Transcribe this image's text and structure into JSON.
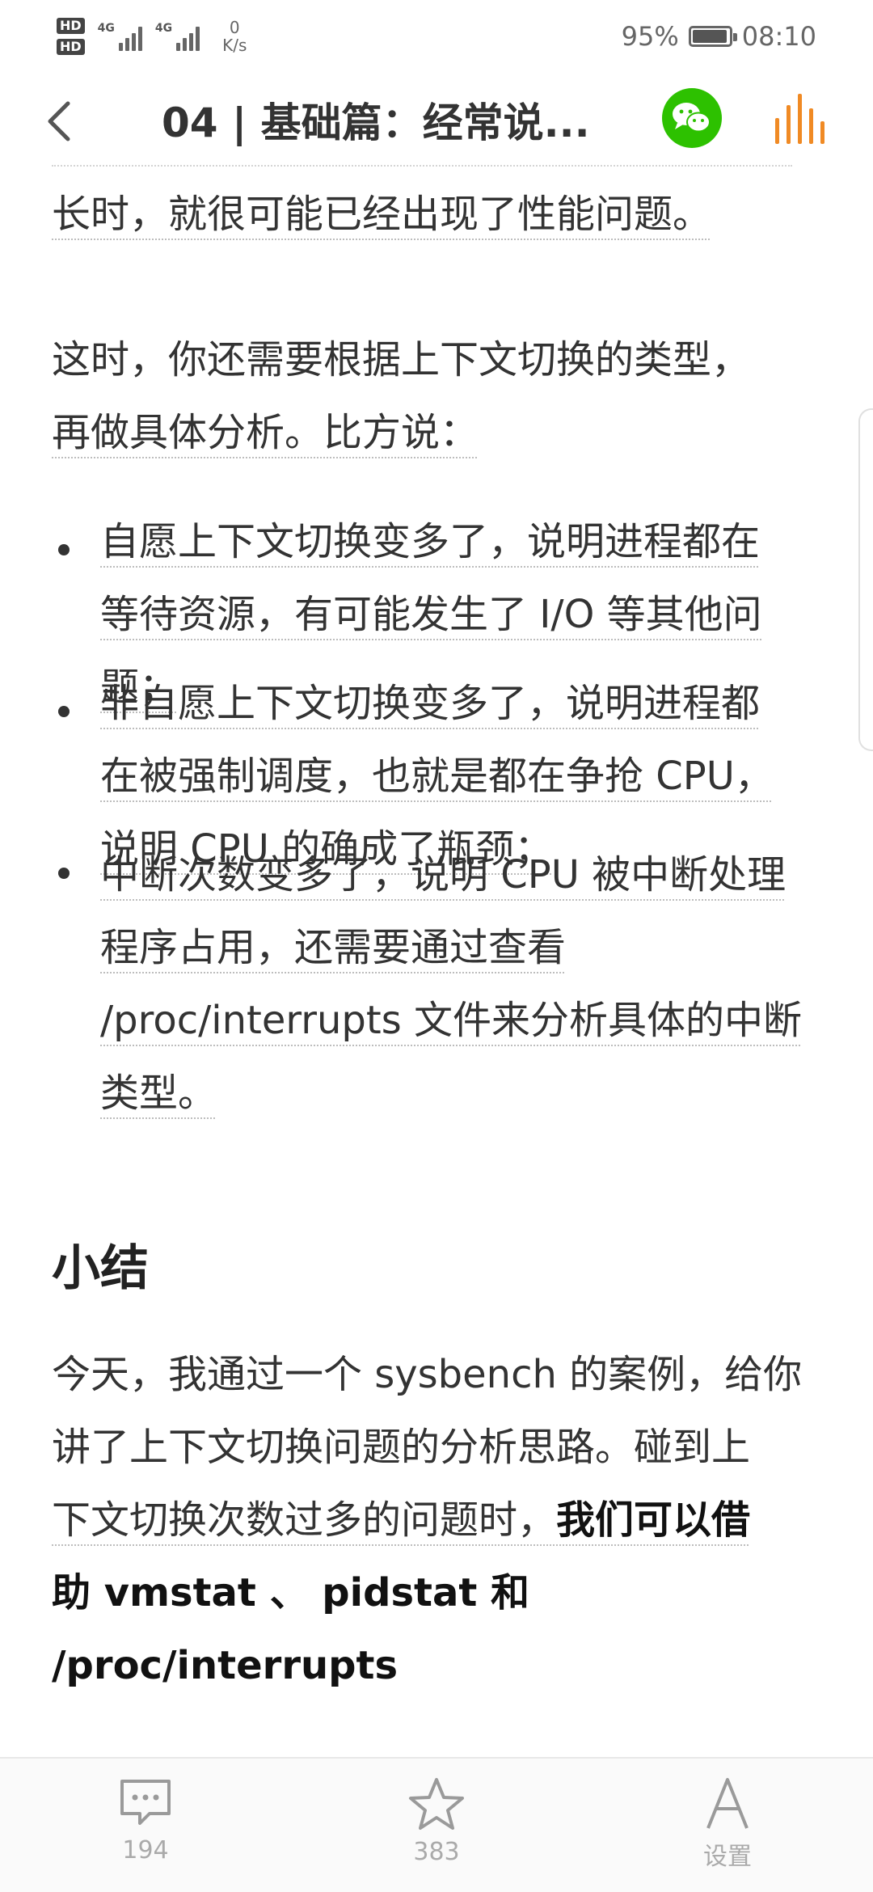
{
  "status_bar": {
    "hd1": "HD",
    "hd2": "HD",
    "network_1": "4G",
    "network_2": "4G",
    "speed_value": "0",
    "speed_unit": "K/s",
    "battery_percent": "95%",
    "battery_level": 0.95,
    "time": "08:10"
  },
  "header": {
    "title": "04 | 基础篇：经常说..."
  },
  "article": {
    "p1": "长时，就很可能已经出现了性能问题。",
    "p2_line1": "这时，你还需要根据上下文切换的类型，",
    "p2_line2": "再做具体分析。比方说：",
    "bullets": [
      {
        "lines": [
          "自愿上下文切换变多了，说明进程都在",
          "等待资源，有可能发生了 I/O 等其他问",
          "题；"
        ]
      },
      {
        "lines": [
          "非自愿上下文切换变多了，说明进程都",
          "在被强制调度，也就是都在争抢 CPU，",
          "说明 CPU 的确成了瓶颈；"
        ]
      },
      {
        "lines": [
          "中断次数变多了，说明 CPU 被中断处理",
          "程序占用，还需要通过查看",
          "/proc/interrupts 文件来分析具体的中断",
          "类型。"
        ]
      }
    ],
    "heading_summary": "小结",
    "summary_line1": "今天，我通过一个 sysbench 的案例，给你",
    "summary_line2": "讲了上下文切换问题的分析思路。碰到上",
    "summary_line3_normal": "下文切换次数过多的问题时，",
    "summary_line3_bold": "我们可以借",
    "summary_line4_bold": "助 vmstat 、 pidstat 和 /proc/interrupts"
  },
  "bottom_bar": {
    "comments_count": "194",
    "favorites_count": "383",
    "settings_label": "设置"
  },
  "colors": {
    "accent_orange": "#f08a24",
    "wechat_green": "#2dc100"
  }
}
